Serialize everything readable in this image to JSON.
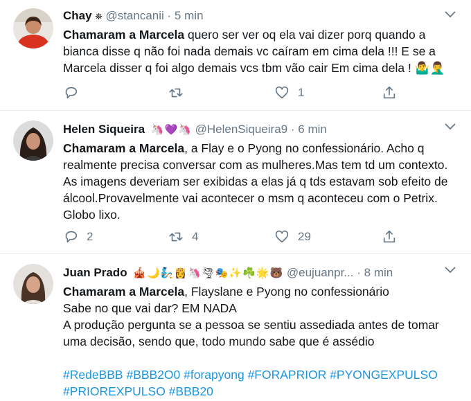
{
  "tweets": [
    {
      "name": "Chay",
      "badge": "⛯",
      "handle": "@stancanii",
      "sep": "·",
      "time": "5 min",
      "body_bold": "Chamaram a Marcela",
      "body_rest": " quero ser ver oq ela vai dizer porq quando a bianca disse q não foi nada demais vc caíram em cima dela !!! E se a Marcela disser q foi algo demais vcs tbm vão cair Em cima dela ! 🤷‍♂️🤦‍♂️",
      "reply_count": "",
      "retweet_count": "",
      "like_count": "1"
    },
    {
      "name": "Helen Siqueira",
      "emojis": "🦄💜🦄",
      "handle": "@HelenSiqueira9",
      "sep": "·",
      "time": "6 min",
      "body_bold": "Chamaram a Marcela",
      "body_rest": ", a Flay e o Pyong no confessionário. Acho q realmente precisa conversar com as mulheres.Mas tem td um contexto. As imagens deveriam ser exibidas a elas já q tds estavam sob efeito de álcool.Provavelmente vai acontecer o msm q aconteceu com o Petrix. Globo lixo.",
      "reply_count": "2",
      "retweet_count": "4",
      "like_count": "29"
    },
    {
      "name": "Juan Prado",
      "emojis": "🎪🌙🧞👸🦄🌪🎭✨☘️🌟🐻",
      "handle": "@eujuanpr...",
      "sep": "·",
      "time": "8 min",
      "body_bold": "Chamaram a Marcela",
      "body_rest": ", Flayslane e Pyong no confessionário",
      "line2": "Sabe no que vai dar? EM NADA",
      "line3": "A produção pergunta se a pessoa se sentiu assediada antes de tomar uma decisão, sendo que, todo mundo sabe que é assédio",
      "hashtags": "#RedeBBB #BBB2O0 #forapyong #FORAPRIOR #PYONGEXPULSO #PRIOREXPULSO #BBB20"
    }
  ],
  "icons": {
    "reply": "reply-icon",
    "retweet": "retweet-icon",
    "like": "heart-icon",
    "share": "share-icon",
    "menu": "chevron-down-icon"
  },
  "colors": {
    "text": "#14171a",
    "muted": "#657786",
    "link": "#1b95e0",
    "divider": "#e6ecf0"
  }
}
